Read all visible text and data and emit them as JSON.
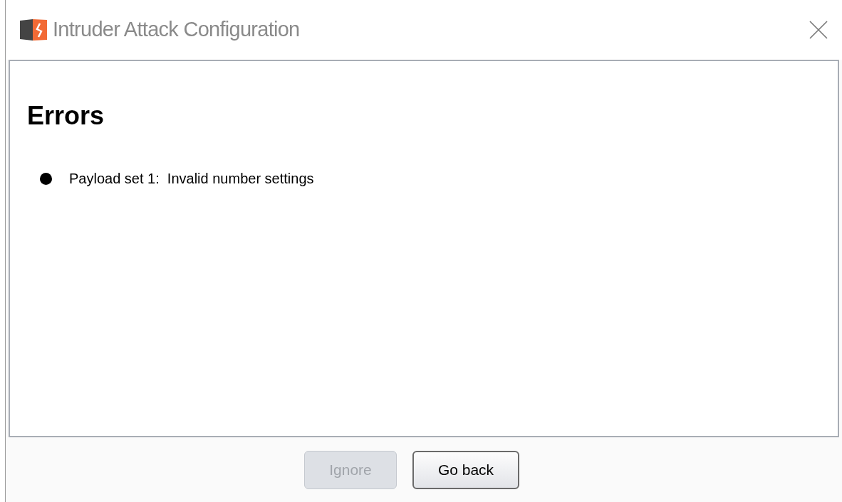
{
  "window": {
    "title": "Intruder Attack Configuration"
  },
  "errors": {
    "heading": "Errors",
    "items": [
      "Payload set 1:  Invalid number settings"
    ]
  },
  "buttons": [
    {
      "label": "Ignore",
      "disabled": true
    },
    {
      "label": "Go back",
      "disabled": false
    }
  ]
}
